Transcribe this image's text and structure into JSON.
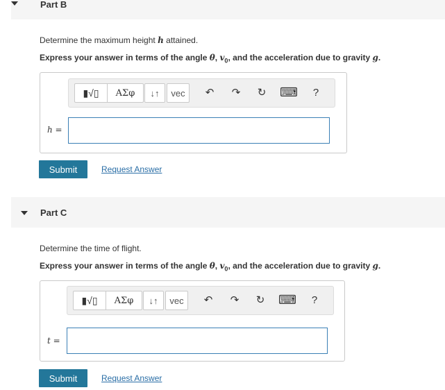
{
  "partB": {
    "title": "Part B",
    "prompt": "Determine the maximum height ",
    "prompt_var": "h",
    "prompt_end": " attained.",
    "instruction_prefix": "Express your answer in terms of the angle ",
    "instruction_theta": "θ",
    "instruction_sep1": ", ",
    "instruction_v0": "v",
    "instruction_v0_sub": "0",
    "instruction_sep2": ", and the acceleration due to gravity ",
    "instruction_g": "g",
    "instruction_end": ".",
    "var_label": "h =",
    "input_value": "",
    "submit_label": "Submit",
    "request_label": "Request Answer"
  },
  "partC": {
    "title": "Part C",
    "prompt": "Determine the time of flight.",
    "instruction_prefix": "Express your answer in terms of the angle ",
    "instruction_theta": "θ",
    "instruction_sep1": ", ",
    "instruction_v0": "v",
    "instruction_v0_sub": "0",
    "instruction_sep2": ", and the acceleration due to gravity ",
    "instruction_g": "g",
    "instruction_end": ".",
    "var_label": "t =",
    "input_value": "",
    "submit_label": "Submit",
    "request_label": "Request Answer"
  },
  "toolbar": {
    "templates": "▮√▯",
    "greek": "ΑΣφ",
    "arrows": "↓↑",
    "vec": "vec",
    "undo": "↶",
    "redo": "↷",
    "reset": "↻",
    "keyboard": "⌨",
    "help": "?"
  },
  "colors": {
    "accent": "#23779a",
    "link": "#2a6ea6",
    "input_border": "#3a7fb5"
  }
}
